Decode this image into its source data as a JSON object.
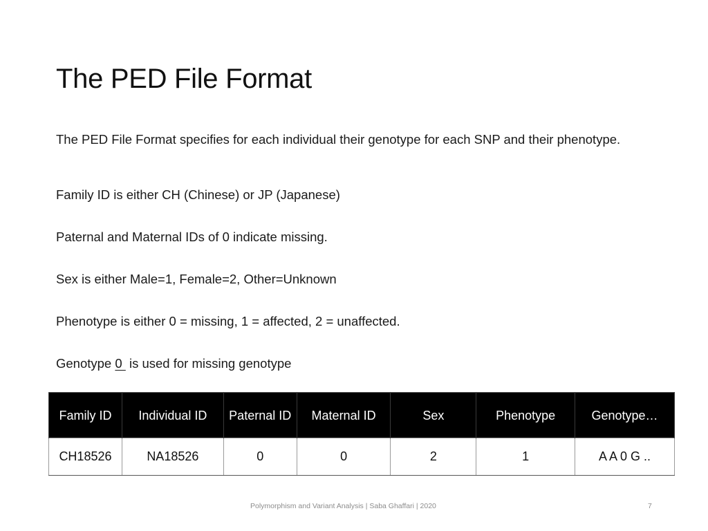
{
  "slide": {
    "title": "The PED File Format",
    "paragraphs": [
      "The PED File Format specifies for each individual their genotype for each SNP and their phenotype.",
      "Family ID is either CH (Chinese) or JP (Japanese)",
      "Paternal and Maternal IDs of 0 indicate missing.",
      "Sex is either Male=1, Female=2, Other=Unknown",
      "Phenotype is either 0 = missing, 1 = affected, 2 = unaffected."
    ],
    "genotype_line": {
      "prefix": "Genotype ",
      "underlined": "0 ",
      "suffix": " is used for missing genotype"
    }
  },
  "table": {
    "headers": [
      "Family ID",
      "Individual ID",
      "Paternal ID",
      "Maternal ID",
      "Sex",
      "Phenotype",
      "Genotype…"
    ],
    "rows": [
      [
        "CH18526",
        "NA18526",
        "0",
        "0",
        "2",
        "1",
        "A A 0 G .."
      ]
    ]
  },
  "footer": {
    "text": "Polymorphism and Variant Analysis | Saba Ghaffari | 2020",
    "page_number": "7"
  }
}
